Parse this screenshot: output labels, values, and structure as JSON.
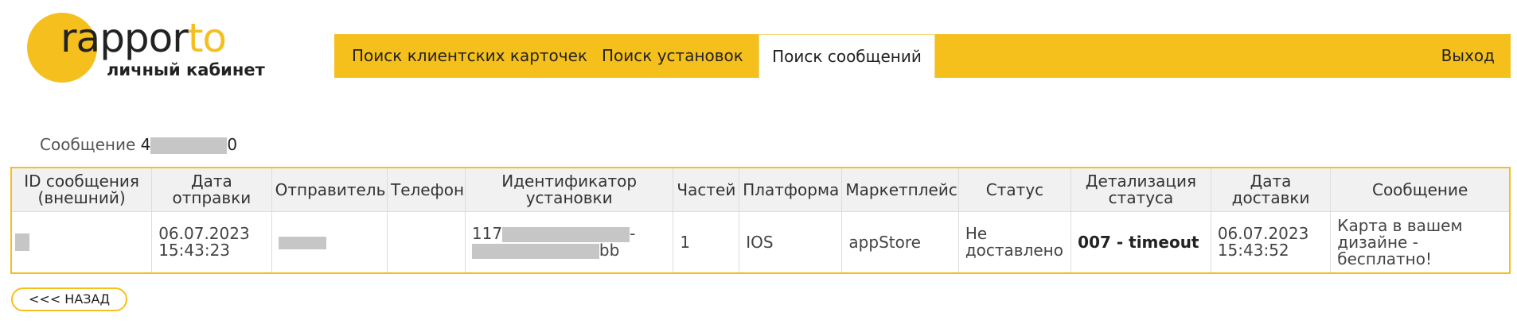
{
  "brand": {
    "logo_part1": "rappor",
    "logo_part2": "to",
    "subtitle": "личный кабинет",
    "accent_color": "#f5c01c"
  },
  "nav": {
    "items": [
      {
        "label": "Поиск клиентских карточек",
        "active": false
      },
      {
        "label": "Поиск установок",
        "active": false
      },
      {
        "label": "Поиск сообщений",
        "active": true
      }
    ],
    "logout": "Выход"
  },
  "message": {
    "label": "Сообщение",
    "id_start": "4",
    "id_end": "0"
  },
  "table": {
    "headers": [
      "ID сообщения (внешний)",
      "Дата отправки",
      "Отправитель",
      "Телефон",
      "Идентификатор установки",
      "Частей",
      "Платформа",
      "Маркетплейс",
      "Статус",
      "Детализация статуса",
      "Дата доставки",
      "Сообщение"
    ],
    "row": {
      "external_id": "",
      "send_date": "06.07.2023 15:43:23",
      "sender": "",
      "phone": "",
      "install_id_start": "117",
      "install_id_mid": "-",
      "install_id_end": "bb",
      "parts": "1",
      "platform": "IOS",
      "marketplace": "appStore",
      "status": "Не доставлено",
      "status_detail": "007 - timeout",
      "delivery_date": "06.07.2023 15:43:52",
      "text": "Карта в вашем дизайне - бесплатно!"
    }
  },
  "back_button": "<<< НАЗАД"
}
